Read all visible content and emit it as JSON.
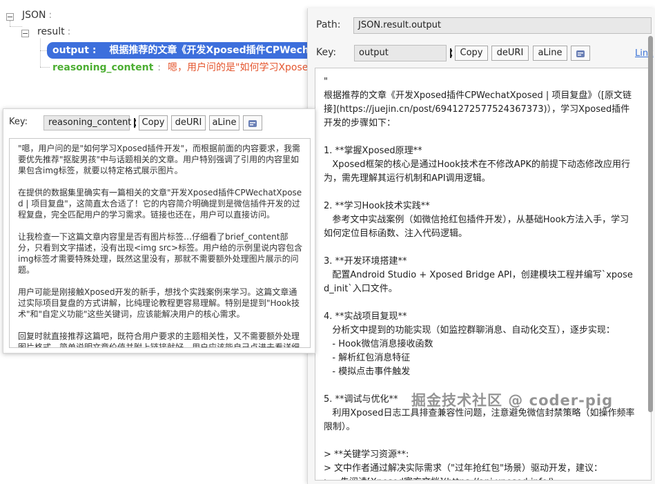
{
  "tree": {
    "root": "JSON",
    "result": "result",
    "output_key": "output",
    "output_colon": ":",
    "output_preview": "根据推荐的文章《开发Xposed插件CPWechatXposed | 项目复盘》（[原文链接](https://juejin.cn/post/6941272577524367373)），学习Xposed插件开发的步骤如下：",
    "rc_key": "reasoning_content",
    "rc_colon": ":",
    "rc_preview": "嗯，用户问的是\"如何学习Xposed插件开发\"，而根据前面的内容要求"
  },
  "left_panel": {
    "key_label": "Key:",
    "key_value": "reasoning_content",
    "copy": "Copy",
    "deuri": "deURI",
    "aline": "aLine",
    "content": "\"嗯，用户问的是\"如何学习Xposed插件开发\"，而根据前面的内容要求，我需要优先推荐\"抠腚男孩\"中与话题相关的文章。用户特别强调了引用的内容里如果包含img标签，就要以特定格式展示图片。\n\n在提供的数据集里确实有一篇相关的文章\"开发Xposed插件CPWechatXposed | 项目复盘\"，这简直太合适了！它的内容简介明确提到是微信插件开发的过程复盘，完全匹配用户的学习需求。链接也还在，用户可以直接访问。\n\n让我检查一下这篇文章内容里是否有图片标签…仔细看了brief_content部分，只看到文字描述，没有出现<img src>标签。用户给的示例里说内容包含img标签才需要特殊处理，既然这里没有，那就不需要额外处理图片展示的问题。\n\n用户可能是刚接触Xposed开发的新手，想找个实践案例来学习。这篇文章通过实际项目复盘的方式讲解，比纯理论教程更容易理解。特别是提到\"Hook技术\"和\"自定义功能\"这些关键词，应该能解决用户的核心需求。\n\n回复时就直接推荐这篇吧，既符合用户要求的主题相关性，又不需要额外处理图片格式。简单说明文章价值并附上链接就好，用户应该能自己点进去看详细内容。\n\""
  },
  "right_panel": {
    "path_label": "Path:",
    "path_value": "JSON.result.output",
    "key_label": "Key:",
    "key_value": "output",
    "copy": "Copy",
    "deuri": "deURI",
    "aline": "aLine",
    "link": "Link",
    "content": "\"\n根据推荐的文章《开发Xposed插件CPWechatXposed | 项目复盘》（[原文链接](https://juejin.cn/post/6941272577524367373)），学习Xposed插件开发的步骤如下：\n\n1. **掌握Xposed原理**\n   Xposed框架的核心是通过Hook技术在不修改APK的前提下动态修改应用行为，需先理解其运行机制和API调用逻辑。\n\n2. **学习Hook技术实践**\n   参考文中实战案例（如微信抢红包插件开发），从基础Hook方法入手，学习如何定位目标函数、注入代码逻辑。\n\n3. **开发环境搭建**\n   配置Android Studio + Xposed Bridge API，创建模块工程并编写`xposed_init`入口文件。\n\n4. **实战项目复现**\n   分析文中提到的功能实现（如监控群聊消息、自动化交互），逐步实现：\n   - Hook微信消息接收函数\n   - 解析红包消息特征\n   - 模拟点击事件触发\n\n5. **调试与优化**\n   利用Xposed日志工具排查兼容性问题，注意避免微信封禁策略（如操作频率限制）。\n\n> **关键学习资源**:\n> 文中作者通过解决实际需求（\"过年抢红包\"场景）驱动开发，建议：\n> - 先阅读[Xposed官方文档](https://api.xposed.info/)\n> - 再结合该项目的[开源代码](https://github.com/coder-pig/CPWechatXposed)进行调试\n> - 重点研究`handleLoadPackage`的实现和反射调用技巧\n\n该复盘文章从需求分析到代码实现完整呈现了开发链路，是典型的\"问题驱动型\"学习范例，初学者可快速掌握Hook开发的核心流程。\"",
    "watermark": "掘金技术社区 @ coder-pig"
  },
  "colors": {
    "selected": "#3d6fdc",
    "rc_key": "#4cae33",
    "rc_value": "#e4562f",
    "link": "#3a72d6"
  },
  "icons": [
    "toggle-collapse-icon",
    "wrap-icon"
  ]
}
